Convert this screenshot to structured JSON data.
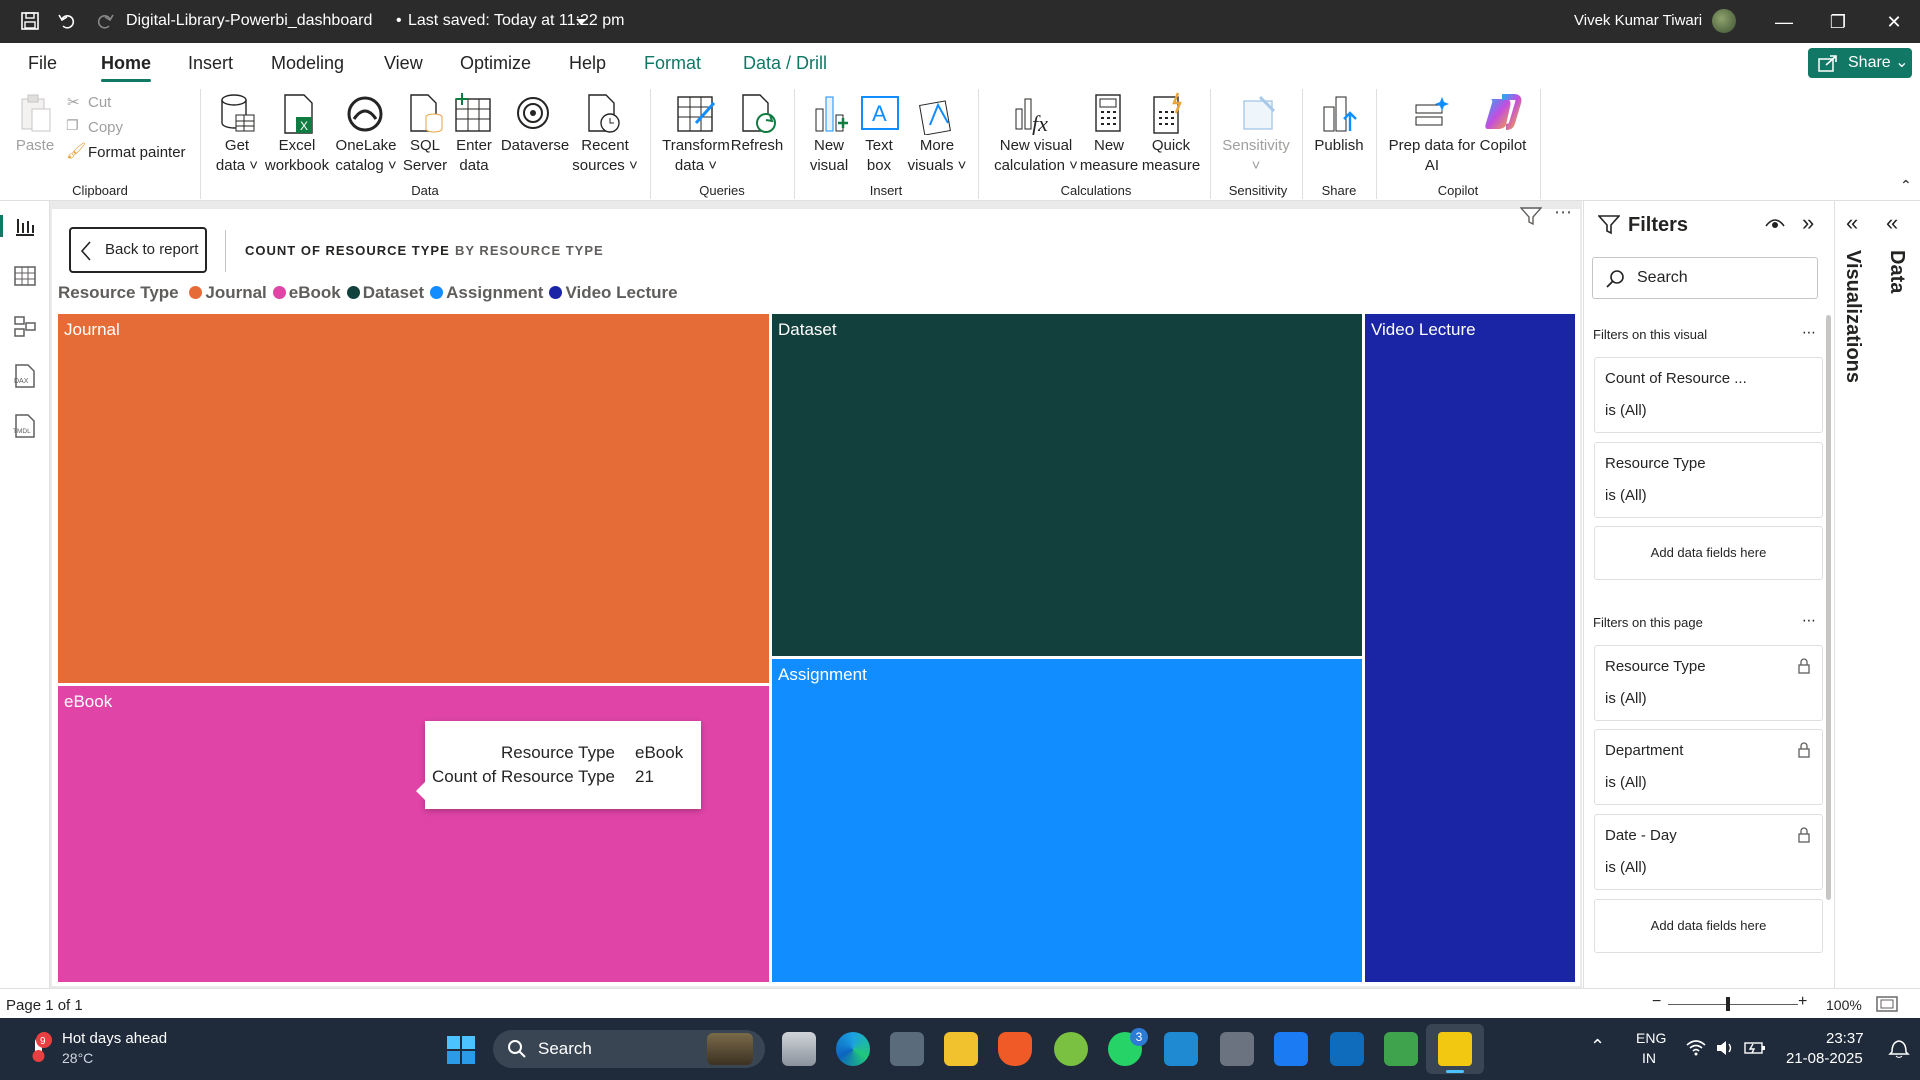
{
  "titlebar": {
    "doc_title": "Digital-Library-Powerbi_dashboard",
    "saved": "Last saved: Today at 11:22 pm",
    "user": "Vivek Kumar Tiwari"
  },
  "menu": {
    "items": [
      "File",
      "Home",
      "Insert",
      "Modeling",
      "View",
      "Optimize",
      "Help",
      "Format",
      "Data / Drill"
    ],
    "share": "Share"
  },
  "ribbon": {
    "clipboard": {
      "paste": "Paste",
      "cut": "Cut",
      "copy": "Copy",
      "format_painter": "Format painter",
      "group": "Clipboard"
    },
    "data": {
      "get_data": [
        "Get",
        "data"
      ],
      "excel": [
        "Excel",
        "workbook"
      ],
      "onelake": [
        "OneLake",
        "catalog"
      ],
      "sql": [
        "SQL",
        "Server"
      ],
      "enter": [
        "Enter",
        "data"
      ],
      "dataverse": "Dataverse",
      "recent": [
        "Recent",
        "sources"
      ],
      "group": "Data"
    },
    "queries": {
      "transform": [
        "Transform",
        "data"
      ],
      "refresh": "Refresh",
      "group": "Queries"
    },
    "insert": {
      "new_visual": [
        "New",
        "visual"
      ],
      "text_box": [
        "Text",
        "box"
      ],
      "more_visuals": [
        "More",
        "visuals"
      ],
      "group": "Insert"
    },
    "calculations": {
      "new_visual_calc": [
        "New visual",
        "calculation"
      ],
      "new_measure": [
        "New",
        "measure"
      ],
      "quick_measure": [
        "Quick",
        "measure"
      ],
      "group": "Calculations"
    },
    "sensitivity": {
      "label": "Sensitivity",
      "group": "Sensitivity"
    },
    "share": {
      "publish": "Publish",
      "group": "Share"
    },
    "copilot": {
      "prep": [
        "Prep data for",
        "AI"
      ],
      "copilot": "Copilot",
      "group": "Copilot"
    }
  },
  "visual": {
    "back_button": "Back to report",
    "breadcrumb": [
      "COUNT OF RESOURCE TYPE",
      "BY RESOURCE TYPE"
    ],
    "legend_title": "Resource Type",
    "tooltip": {
      "rows": [
        {
          "label": "Resource Type",
          "value": "eBook"
        },
        {
          "label": "Count of Resource Type",
          "value": "21"
        }
      ]
    }
  },
  "chart_data": {
    "type": "treemap",
    "legend": [
      {
        "name": "Journal",
        "color": "#e66c37"
      },
      {
        "name": "eBook",
        "color": "#e044a7"
      },
      {
        "name": "Dataset",
        "color": "#12403c"
      },
      {
        "name": "Assignment",
        "color": "#118dff"
      },
      {
        "name": "Video Lecture",
        "color": "#1a25a6"
      }
    ],
    "categories": [
      "Journal",
      "eBook",
      "Dataset",
      "Assignment",
      "Video Lecture"
    ],
    "values": [
      null,
      21,
      null,
      null,
      null
    ],
    "measure": "Count of Resource Type"
  },
  "filters": {
    "title": "Filters",
    "search_placeholder": "Search",
    "on_visual_label": "Filters on this visual",
    "on_visual": [
      {
        "field": "Count of Resource ...",
        "state": "is (All)"
      },
      {
        "field": "Resource Type",
        "state": "is (All)"
      }
    ],
    "add_fields": "Add data fields here",
    "on_page_label": "Filters on this page",
    "on_page": [
      {
        "field": "Resource Type",
        "state": "is (All)"
      },
      {
        "field": "Department",
        "state": "is (All)"
      },
      {
        "field": "Date - Day",
        "state": "is (All)"
      }
    ]
  },
  "panes": {
    "visualizations": "Visualizations",
    "data": "Data"
  },
  "status": {
    "page": "Page 1 of 1",
    "zoom": "100%"
  },
  "taskbar": {
    "weather_title": "Hot days ahead",
    "weather_temp": "28°C",
    "search": "Search",
    "lang1": "ENG",
    "lang2": "IN",
    "time": "23:37",
    "date": "21-08-2025",
    "whatsapp_badge": "3"
  }
}
